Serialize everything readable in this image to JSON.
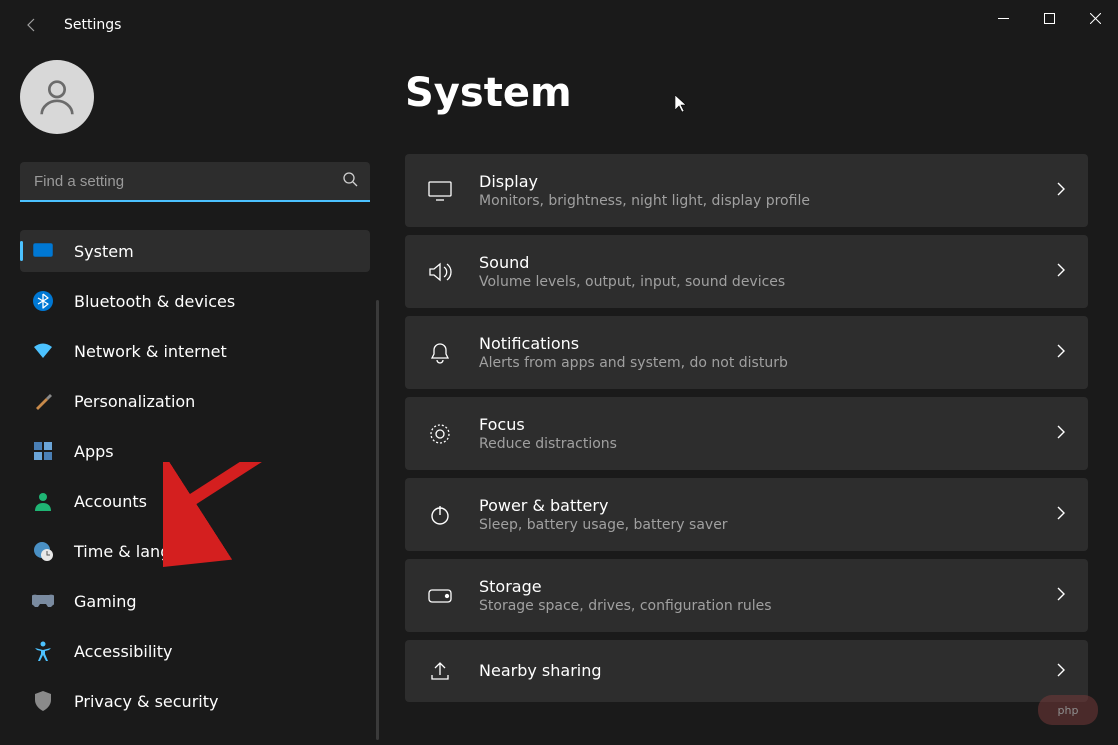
{
  "window": {
    "title": "Settings"
  },
  "search": {
    "placeholder": "Find a setting"
  },
  "sidebar": {
    "items": [
      {
        "label": "System",
        "icon": "system"
      },
      {
        "label": "Bluetooth & devices",
        "icon": "bluetooth"
      },
      {
        "label": "Network & internet",
        "icon": "wifi"
      },
      {
        "label": "Personalization",
        "icon": "brush"
      },
      {
        "label": "Apps",
        "icon": "apps"
      },
      {
        "label": "Accounts",
        "icon": "person"
      },
      {
        "label": "Time & language",
        "icon": "globe-clock"
      },
      {
        "label": "Gaming",
        "icon": "gamepad"
      },
      {
        "label": "Accessibility",
        "icon": "accessibility"
      },
      {
        "label": "Privacy & security",
        "icon": "shield"
      }
    ]
  },
  "page": {
    "title": "System"
  },
  "settings": [
    {
      "title": "Display",
      "desc": "Monitors, brightness, night light, display profile"
    },
    {
      "title": "Sound",
      "desc": "Volume levels, output, input, sound devices"
    },
    {
      "title": "Notifications",
      "desc": "Alerts from apps and system, do not disturb"
    },
    {
      "title": "Focus",
      "desc": "Reduce distractions"
    },
    {
      "title": "Power & battery",
      "desc": "Sleep, battery usage, battery saver"
    },
    {
      "title": "Storage",
      "desc": "Storage space, drives, configuration rules"
    },
    {
      "title": "Nearby sharing",
      "desc": ""
    }
  ],
  "colors": {
    "accent": "#4cc2ff",
    "bg": "#1a1a1a",
    "card": "#2d2d2d",
    "arrow": "#d41f1f"
  }
}
